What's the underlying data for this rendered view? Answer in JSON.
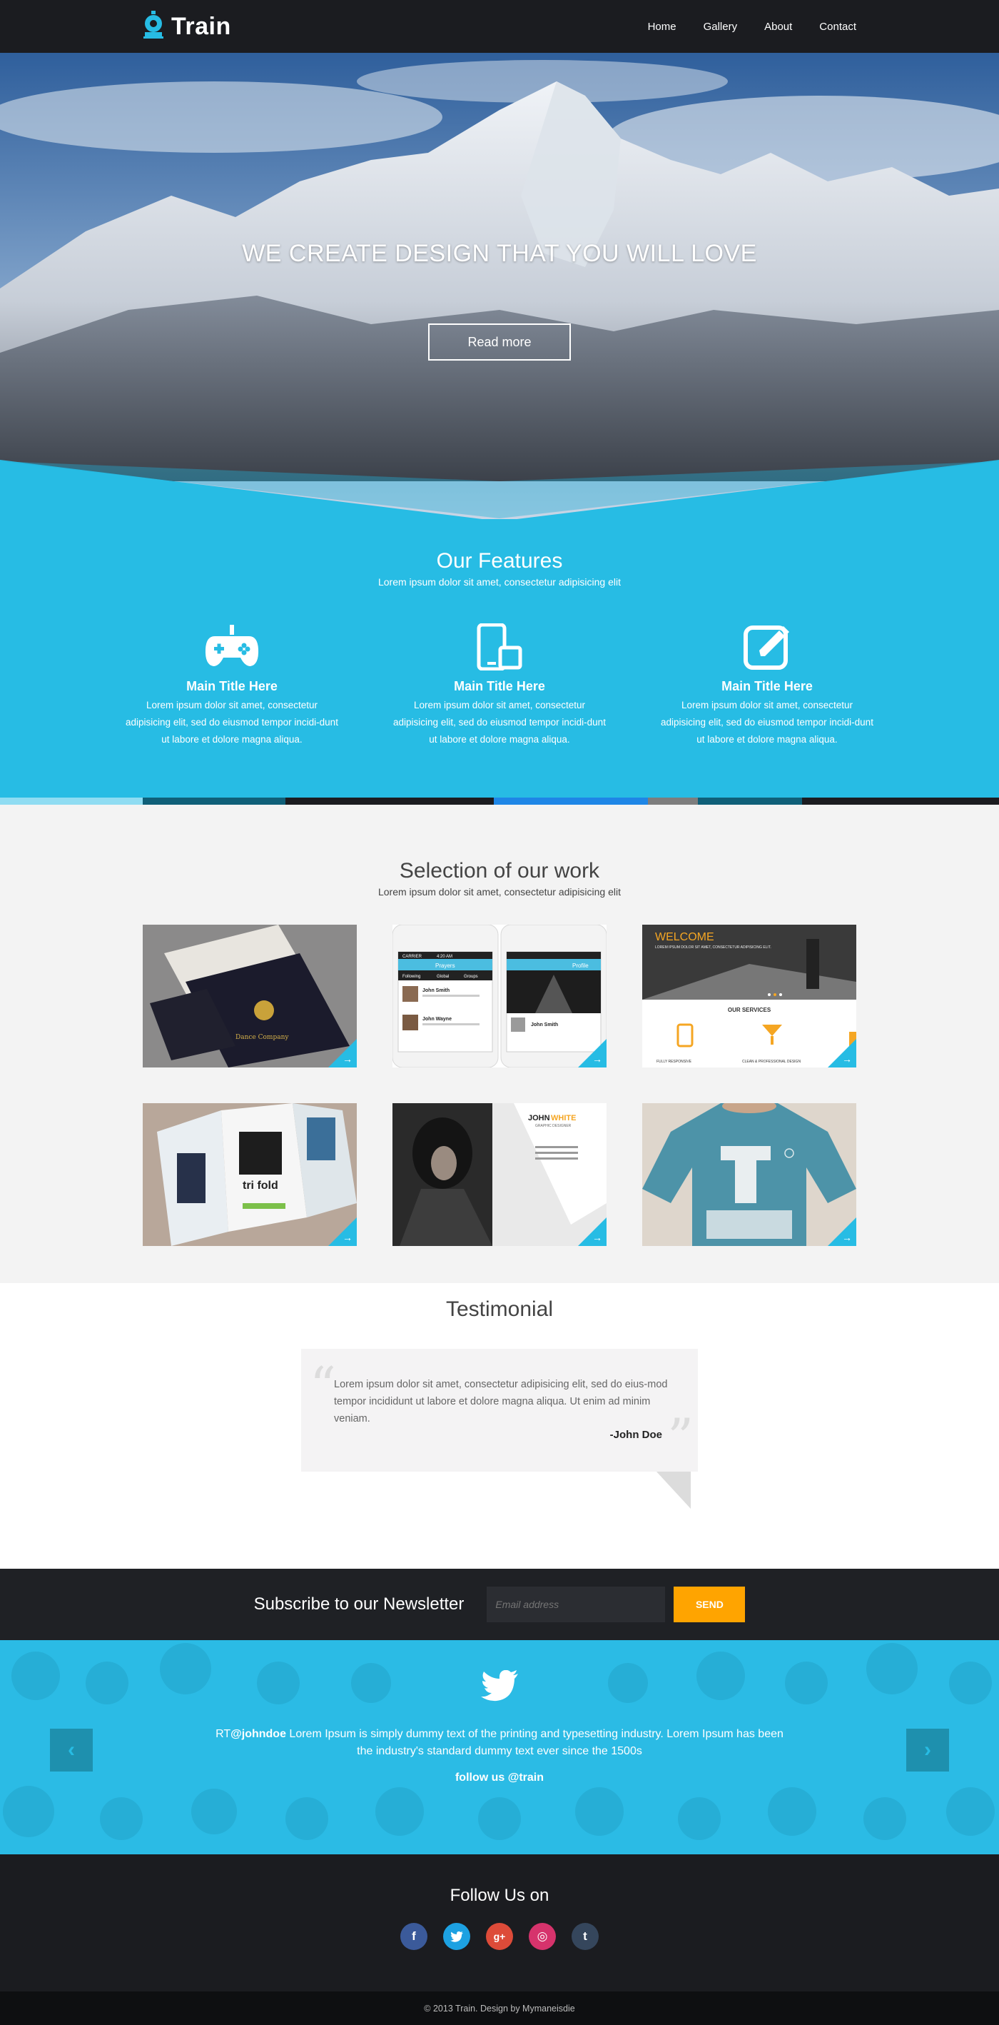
{
  "header": {
    "logo_text": "Train",
    "nav": [
      "Home",
      "Gallery",
      "About",
      "Contact"
    ]
  },
  "hero": {
    "headline": "WE CREATE DESIGN THAT YOU WILL LOVE",
    "button": "Read more"
  },
  "features": {
    "title": "Our Features",
    "subtitle": "Lorem ipsum dolor sit amet, consectetur adipisicing elit",
    "items": [
      {
        "icon": "gamepad-icon",
        "title": "Main Title Here",
        "text": "Lorem ipsum dolor sit amet, consectetur adipisicing elit, sed do eiusmod tempor incidi-dunt ut labore et dolore magna aliqua."
      },
      {
        "icon": "devices-icon",
        "title": "Main Title Here",
        "text": "Lorem ipsum dolor sit amet, consectetur adipisicing elit, sed do eiusmod tempor incidi-dunt ut labore et dolore magna aliqua."
      },
      {
        "icon": "edit-icon",
        "title": "Main Title Here",
        "text": "Lorem ipsum dolor sit amet, consectetur adipisicing elit, sed do eiusmod tempor incidi-dunt ut labore et dolore magna aliqua."
      }
    ]
  },
  "colorbar": [
    "#8fdcf2",
    "#0f5f78",
    "#1b1c20",
    "#1b1c20",
    "#1e86e6",
    "#7d7d7d",
    "#0f5f78",
    "#1b1c20"
  ],
  "work": {
    "title": "Selection of our work",
    "subtitle": "Lorem ipsum dolor sit amet, consectetur adipisicing elit",
    "thumbs": {
      "t1": {
        "card": "Dance Company"
      },
      "t2": {
        "carrier": "CARRIER",
        "time": "4:20 AM",
        "screen_a": "Prayers",
        "screen_b": "Profile",
        "tabs": [
          "Following",
          "Global",
          "Groups"
        ],
        "names": [
          "John Smith",
          "John Wayne"
        ],
        "profile_name": "John Smith"
      },
      "t3": {
        "welcome": "WELCOME",
        "welcome_sub": "LOREM IPSUM DOLOR SIT AMET, CONSECTETUR ADIPISICING ELIT.",
        "services": "OUR SERVICES",
        "s1": "FULLY RESPONSIVE",
        "s2": "CLEAN & PROFESSIONAL DESIGN"
      },
      "t4": {
        "text": "tri fold"
      },
      "t5": {
        "name_a": "JOHN",
        "name_b": "WHITE",
        "role": "GRAPHIC DESIGNER"
      },
      "t6": {}
    }
  },
  "testimonial": {
    "title": "Testimonial",
    "quote": "Lorem ipsum dolor sit amet, consectetur adipisicing elit, sed do eius-mod tempor incididunt ut labore et dolore magna aliqua. Ut enim ad minim veniam.",
    "author": "-John Doe"
  },
  "newsletter": {
    "title": "Subscribe to our Newsletter",
    "placeholder": "Email address",
    "button": "SEND"
  },
  "twitter": {
    "rt": "RT",
    "handle": "@johndoe",
    "tweet": " Lorem Ipsum is simply dummy text of the printing and typesetting industry. Lorem Ipsum has been the industry's standard dummy text ever since the 1500s",
    "follow": "follow us @train"
  },
  "follow": {
    "title": "Follow Us on",
    "socials": [
      {
        "name": "facebook-icon",
        "glyph": "f",
        "color": "#3b5a9a"
      },
      {
        "name": "twitter-icon",
        "glyph": "t",
        "color": "#1da1e2"
      },
      {
        "name": "google-plus-icon",
        "glyph": "g+",
        "color": "#dd4b39"
      },
      {
        "name": "dribbble-icon",
        "glyph": "◎",
        "color": "#d6336c"
      },
      {
        "name": "tumblr-icon",
        "glyph": "t",
        "color": "#35465c"
      }
    ]
  },
  "footer": {
    "text": "© 2013 Train. Design by Mymaneisdie"
  },
  "colors": {
    "accent": "#27bce4",
    "dark": "#1b1c20",
    "send": "#ffa400"
  }
}
